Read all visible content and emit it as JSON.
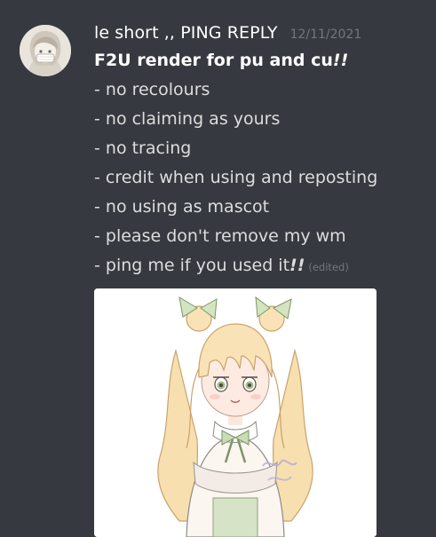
{
  "message": {
    "author": "le short ,, PING REPLY",
    "timestamp": "12/11/2021",
    "title_text": "F2U render for pu and cu",
    "title_emphasis": "!!",
    "rules": [
      "- no recolours",
      "- no claiming as yours",
      "- no tracing",
      "- credit when using and reposting",
      "- no using as mascot",
      "- please don't remove my wm"
    ],
    "last_line_text": "- ping me if you used it",
    "last_line_emphasis": "!!",
    "edited_label": "(edited)",
    "avatar_icon": "chibi-avatar-icon",
    "attachment_icon": "character-render-image"
  },
  "colors": {
    "background": "#36393f",
    "username": "#ffffff",
    "timestamp": "#72767d",
    "text": "#dcddde"
  }
}
